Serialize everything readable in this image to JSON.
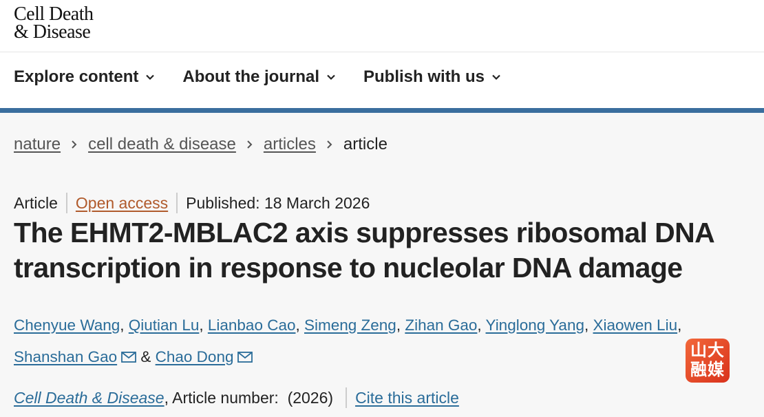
{
  "logo": {
    "line1": "Cell Death",
    "line2": "& Disease"
  },
  "nav": {
    "items": [
      {
        "label": "Explore content"
      },
      {
        "label": "About the journal"
      },
      {
        "label": "Publish with us"
      }
    ]
  },
  "breadcrumb": {
    "items": [
      "nature",
      "cell death & disease",
      "articles"
    ],
    "current": "article"
  },
  "article": {
    "type": "Article",
    "access": "Open access",
    "published": "Published: 18 March 2026",
    "title": "The EHMT2-MBLAC2 axis suppresses ribosomal DNA transcription in response to nucleolar DNA damage",
    "authors": [
      "Chenyue Wang",
      "Qiutian Lu",
      "Lianbao Cao",
      "Simeng Zeng",
      "Zihan Gao",
      "Yinglong Yang",
      "Xiaowen Liu",
      "Shanshan Gao",
      "Chao Dong"
    ],
    "journal": "Cell Death & Disease",
    "article_number": ", Article number:  (2026)",
    "cite": "Cite this article"
  },
  "badge": {
    "line1": "山大",
    "line2": "融媒"
  },
  "colors": {
    "link": "#2a6c99",
    "open_access": "#b05a2b",
    "accent_bar": "#3a6e9e"
  }
}
